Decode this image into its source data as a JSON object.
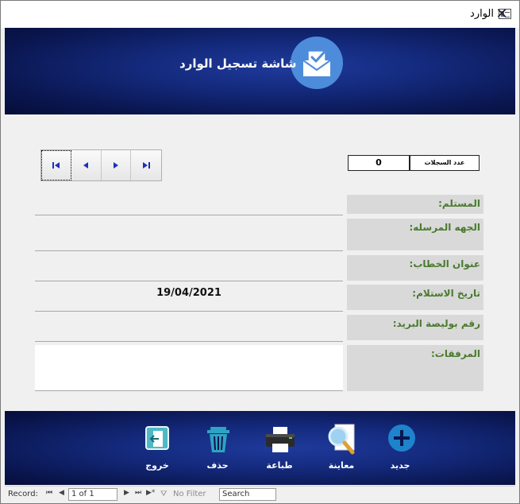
{
  "window": {
    "title": "الوارد",
    "close_glyph": "✕"
  },
  "header": {
    "title": "شاشة تسجيل الوارد",
    "icon": "mail-check-icon"
  },
  "records": {
    "count_label": "عدد السجلات",
    "count_value": "0"
  },
  "navigation": {
    "first": "first-record-icon",
    "prev": "prev-record-icon",
    "next": "next-record-icon",
    "last": "last-record-icon"
  },
  "fields": {
    "recipient": {
      "label": "المستلم:",
      "value": ""
    },
    "sender_party": {
      "label": "الجهه المرسله:",
      "value": ""
    },
    "subject": {
      "label": "عنوان الخطاب:",
      "value": ""
    },
    "received_date": {
      "label": "تاريخ الاستلام:",
      "value": "19/04/2021"
    },
    "mail_policy": {
      "label": "رقم بوليصة البريد:",
      "value": ""
    },
    "attachments": {
      "label": "المرفقات:",
      "value": ""
    }
  },
  "actions": {
    "exit": "خروج",
    "delete": "حذف",
    "print": "طباعة",
    "preview": "معاينة",
    "new": "جديد"
  },
  "statusbar": {
    "record_label": "Record:",
    "position": "1 of 1",
    "filter": "No Filter",
    "search": "Search"
  },
  "colors": {
    "header_blue": "#142a7d",
    "label_green": "#4a7a2e",
    "label_bg": "#d9d9d9",
    "badge_blue": "#4d8cdb"
  }
}
